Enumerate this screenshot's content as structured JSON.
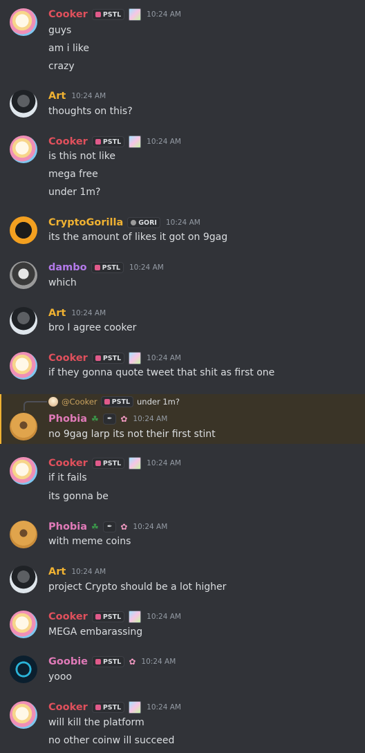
{
  "colors": {
    "cooker": "#e0505c",
    "art": "#f0b232",
    "cryptogorilla": "#f0b232",
    "dambo": "#b279e8",
    "phobia": "#e07ab8",
    "goobie": "#e07ab8",
    "reply_highlight": "#3a3427"
  },
  "tags": {
    "pstl": "PSTL",
    "gori": "GORI"
  },
  "messages": [
    {
      "author": "Cooker",
      "time": "10:24 AM",
      "lines": [
        "guys",
        "am i like",
        "crazy"
      ]
    },
    {
      "author": "Art",
      "time": "10:24 AM",
      "lines": [
        "thoughts on this?"
      ]
    },
    {
      "author": "Cooker",
      "time": "10:24 AM",
      "lines": [
        "is this not like",
        "mega free",
        "under 1m?"
      ]
    },
    {
      "author": "CryptoGorilla",
      "time": "10:24 AM",
      "lines": [
        "its the amount of likes it got on 9gag"
      ]
    },
    {
      "author": "dambo",
      "time": "10:24 AM",
      "lines": [
        "which"
      ]
    },
    {
      "author": "Art",
      "time": "10:24 AM",
      "lines": [
        "bro I agree cooker"
      ]
    },
    {
      "author": "Cooker",
      "time": "10:24 AM",
      "lines": [
        "if they gonna quote tweet that shit as first one"
      ]
    },
    {
      "author": "Phobia",
      "time": "10:24 AM",
      "lines": [
        "no 9gag larp its not their first stint"
      ],
      "reply": {
        "name": "@Cooker",
        "text": "under 1m?"
      }
    },
    {
      "author": "Cooker",
      "time": "10:24 AM",
      "lines": [
        "if it fails",
        "its gonna be"
      ]
    },
    {
      "author": "Phobia",
      "time": "10:24 AM",
      "lines": [
        "with meme coins"
      ]
    },
    {
      "author": "Art",
      "time": "10:24 AM",
      "lines": [
        "project Crypto should be a lot higher"
      ]
    },
    {
      "author": "Cooker",
      "time": "10:24 AM",
      "lines": [
        "MEGA embarassing"
      ]
    },
    {
      "author": "Goobie",
      "time": "10:24 AM",
      "lines": [
        "yooo"
      ]
    },
    {
      "author": "Cooker",
      "time": "10:24 AM",
      "lines": [
        "will kill the platform",
        "no other coinw ill succeed"
      ]
    }
  ]
}
